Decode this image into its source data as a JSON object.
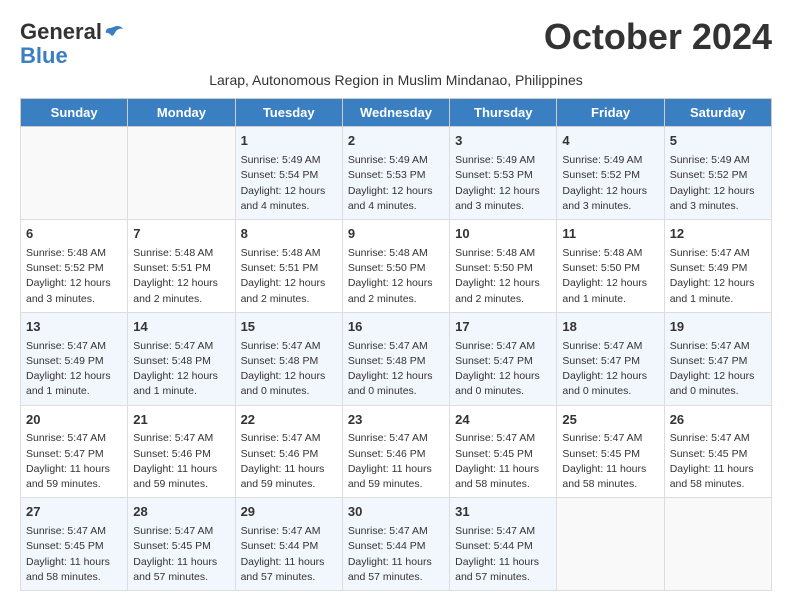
{
  "logo": {
    "line1": "General",
    "line2": "Blue"
  },
  "title": "October 2024",
  "subtitle": "Larap, Autonomous Region in Muslim Mindanao, Philippines",
  "days_of_week": [
    "Sunday",
    "Monday",
    "Tuesday",
    "Wednesday",
    "Thursday",
    "Friday",
    "Saturday"
  ],
  "weeks": [
    [
      {
        "day": "",
        "info": ""
      },
      {
        "day": "",
        "info": ""
      },
      {
        "day": "1",
        "info": "Sunrise: 5:49 AM\nSunset: 5:54 PM\nDaylight: 12 hours\nand 4 minutes."
      },
      {
        "day": "2",
        "info": "Sunrise: 5:49 AM\nSunset: 5:53 PM\nDaylight: 12 hours\nand 4 minutes."
      },
      {
        "day": "3",
        "info": "Sunrise: 5:49 AM\nSunset: 5:53 PM\nDaylight: 12 hours\nand 3 minutes."
      },
      {
        "day": "4",
        "info": "Sunrise: 5:49 AM\nSunset: 5:52 PM\nDaylight: 12 hours\nand 3 minutes."
      },
      {
        "day": "5",
        "info": "Sunrise: 5:49 AM\nSunset: 5:52 PM\nDaylight: 12 hours\nand 3 minutes."
      }
    ],
    [
      {
        "day": "6",
        "info": "Sunrise: 5:48 AM\nSunset: 5:52 PM\nDaylight: 12 hours\nand 3 minutes."
      },
      {
        "day": "7",
        "info": "Sunrise: 5:48 AM\nSunset: 5:51 PM\nDaylight: 12 hours\nand 2 minutes."
      },
      {
        "day": "8",
        "info": "Sunrise: 5:48 AM\nSunset: 5:51 PM\nDaylight: 12 hours\nand 2 minutes."
      },
      {
        "day": "9",
        "info": "Sunrise: 5:48 AM\nSunset: 5:50 PM\nDaylight: 12 hours\nand 2 minutes."
      },
      {
        "day": "10",
        "info": "Sunrise: 5:48 AM\nSunset: 5:50 PM\nDaylight: 12 hours\nand 2 minutes."
      },
      {
        "day": "11",
        "info": "Sunrise: 5:48 AM\nSunset: 5:50 PM\nDaylight: 12 hours\nand 1 minute."
      },
      {
        "day": "12",
        "info": "Sunrise: 5:47 AM\nSunset: 5:49 PM\nDaylight: 12 hours\nand 1 minute."
      }
    ],
    [
      {
        "day": "13",
        "info": "Sunrise: 5:47 AM\nSunset: 5:49 PM\nDaylight: 12 hours\nand 1 minute."
      },
      {
        "day": "14",
        "info": "Sunrise: 5:47 AM\nSunset: 5:48 PM\nDaylight: 12 hours\nand 1 minute."
      },
      {
        "day": "15",
        "info": "Sunrise: 5:47 AM\nSunset: 5:48 PM\nDaylight: 12 hours\nand 0 minutes."
      },
      {
        "day": "16",
        "info": "Sunrise: 5:47 AM\nSunset: 5:48 PM\nDaylight: 12 hours\nand 0 minutes."
      },
      {
        "day": "17",
        "info": "Sunrise: 5:47 AM\nSunset: 5:47 PM\nDaylight: 12 hours\nand 0 minutes."
      },
      {
        "day": "18",
        "info": "Sunrise: 5:47 AM\nSunset: 5:47 PM\nDaylight: 12 hours\nand 0 minutes."
      },
      {
        "day": "19",
        "info": "Sunrise: 5:47 AM\nSunset: 5:47 PM\nDaylight: 12 hours\nand 0 minutes."
      }
    ],
    [
      {
        "day": "20",
        "info": "Sunrise: 5:47 AM\nSunset: 5:47 PM\nDaylight: 11 hours\nand 59 minutes."
      },
      {
        "day": "21",
        "info": "Sunrise: 5:47 AM\nSunset: 5:46 PM\nDaylight: 11 hours\nand 59 minutes."
      },
      {
        "day": "22",
        "info": "Sunrise: 5:47 AM\nSunset: 5:46 PM\nDaylight: 11 hours\nand 59 minutes."
      },
      {
        "day": "23",
        "info": "Sunrise: 5:47 AM\nSunset: 5:46 PM\nDaylight: 11 hours\nand 59 minutes."
      },
      {
        "day": "24",
        "info": "Sunrise: 5:47 AM\nSunset: 5:45 PM\nDaylight: 11 hours\nand 58 minutes."
      },
      {
        "day": "25",
        "info": "Sunrise: 5:47 AM\nSunset: 5:45 PM\nDaylight: 11 hours\nand 58 minutes."
      },
      {
        "day": "26",
        "info": "Sunrise: 5:47 AM\nSunset: 5:45 PM\nDaylight: 11 hours\nand 58 minutes."
      }
    ],
    [
      {
        "day": "27",
        "info": "Sunrise: 5:47 AM\nSunset: 5:45 PM\nDaylight: 11 hours\nand 58 minutes."
      },
      {
        "day": "28",
        "info": "Sunrise: 5:47 AM\nSunset: 5:45 PM\nDaylight: 11 hours\nand 57 minutes."
      },
      {
        "day": "29",
        "info": "Sunrise: 5:47 AM\nSunset: 5:44 PM\nDaylight: 11 hours\nand 57 minutes."
      },
      {
        "day": "30",
        "info": "Sunrise: 5:47 AM\nSunset: 5:44 PM\nDaylight: 11 hours\nand 57 minutes."
      },
      {
        "day": "31",
        "info": "Sunrise: 5:47 AM\nSunset: 5:44 PM\nDaylight: 11 hours\nand 57 minutes."
      },
      {
        "day": "",
        "info": ""
      },
      {
        "day": "",
        "info": ""
      }
    ]
  ]
}
